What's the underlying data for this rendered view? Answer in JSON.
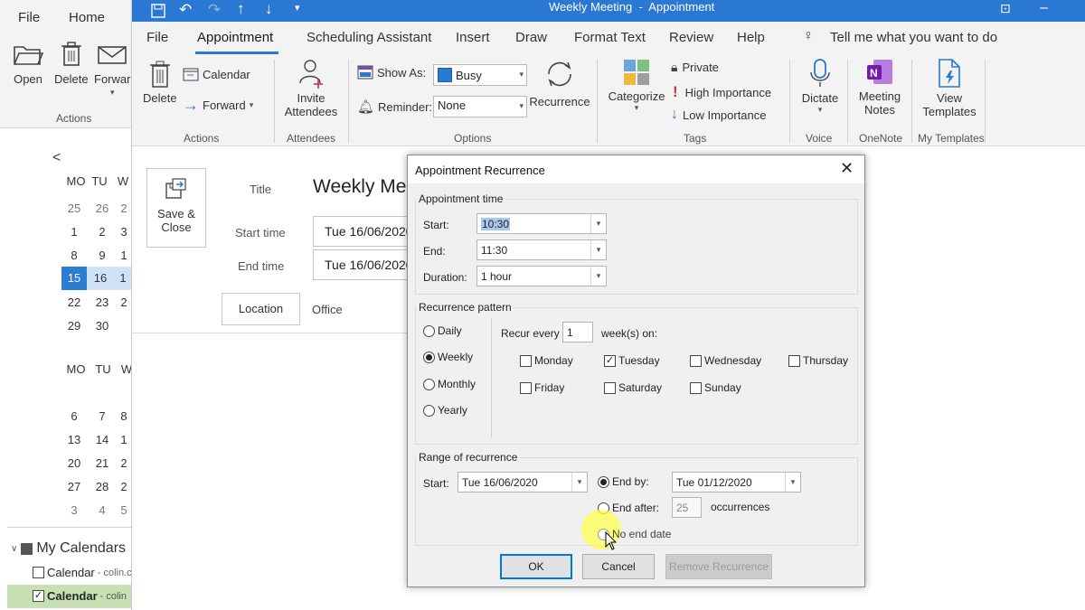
{
  "left_window": {
    "tabs": [
      "File",
      "Home"
    ],
    "ribbon": {
      "open": "Open",
      "delete": "Delete",
      "forward": "Forwar",
      "group": "Actions"
    },
    "calendar": {
      "prev": "<",
      "header1": [
        "MO",
        "TU",
        "W"
      ],
      "weeks1": [
        [
          "25",
          "26",
          "2"
        ],
        [
          "1",
          "2",
          "3"
        ],
        [
          "8",
          "9",
          "1"
        ],
        [
          "15",
          "16",
          "1"
        ],
        [
          "22",
          "23",
          "2"
        ],
        [
          "29",
          "30",
          ""
        ]
      ],
      "header2": [
        "MO",
        "TU",
        "W"
      ],
      "weeks2": [
        [
          "6",
          "7",
          "8"
        ],
        [
          "13",
          "14",
          "1"
        ],
        [
          "20",
          "21",
          "2"
        ],
        [
          "27",
          "28",
          "2"
        ],
        [
          "3",
          "4",
          "5"
        ]
      ]
    },
    "my_calendars": {
      "label": "My Calendars",
      "items": [
        {
          "label": "Calendar",
          "suffix": " - colin.c",
          "checked": false
        },
        {
          "label": "Calendar",
          "suffix": " - colin",
          "checked": true
        }
      ]
    }
  },
  "app_window": {
    "title": "Weekly Meeting  -  Appointment",
    "tabs": [
      "File",
      "Appointment",
      "Scheduling Assistant",
      "Insert",
      "Draw",
      "Format Text",
      "Review",
      "Help"
    ],
    "tell_me": "Tell me what you want to do",
    "ribbon": {
      "delete": "Delete",
      "calendar": "Calendar",
      "forward": "Forward",
      "group_actions": "Actions",
      "invite": "Invite",
      "attendees": "Attendees",
      "group_attendees": "Attendees",
      "show_as_label": "Show As:",
      "show_as_value": "Busy",
      "reminder_label": "Reminder:",
      "reminder_value": "None",
      "recurrence": "Recurrence",
      "group_options": "Options",
      "categorize": "Categorize",
      "private": "Private",
      "high_importance": "High Importance",
      "low_importance": "Low Importance",
      "group_tags": "Tags",
      "dictate": "Dictate",
      "group_voice": "Voice",
      "meeting": "Meeting",
      "notes": "Notes",
      "group_onenote": "OneNote",
      "view": "View",
      "templates": "Templates",
      "group_templates": "My Templates"
    },
    "form": {
      "save": "Save &",
      "close": "Close",
      "title_label": "Title",
      "title_value": "Weekly Mee",
      "start_label": "Start time",
      "start_value": "Tue 16/06/2020",
      "end_label": "End time",
      "end_value": "Tue 16/06/2020",
      "location_btn": "Location",
      "location_value": "Office"
    }
  },
  "dialog": {
    "title": "Appointment Recurrence",
    "appointment_time": {
      "legend": "Appointment time",
      "start_label": "Start:",
      "start_value": "10:30",
      "end_label": "End:",
      "end_value": "11:30",
      "duration_label": "Duration:",
      "duration_value": "1 hour"
    },
    "pattern": {
      "legend": "Recurrence pattern",
      "options": [
        {
          "label": "Daily",
          "selected": false
        },
        {
          "label": "Weekly",
          "selected": true
        },
        {
          "label": "Monthly",
          "selected": false
        },
        {
          "label": "Yearly",
          "selected": false
        }
      ],
      "recur_every_label": "Recur every",
      "recur_every_value": "1",
      "weeks_on": "week(s) on:",
      "days": [
        {
          "label": "Monday",
          "checked": false
        },
        {
          "label": "Tuesday",
          "checked": true
        },
        {
          "label": "Wednesday",
          "checked": false
        },
        {
          "label": "Thursday",
          "checked": false
        },
        {
          "label": "Friday",
          "checked": false
        },
        {
          "label": "Saturday",
          "checked": false
        },
        {
          "label": "Sunday",
          "checked": false
        }
      ]
    },
    "range": {
      "legend": "Range of recurrence",
      "start_label": "Start:",
      "start_value": "Tue 16/06/2020",
      "end_by_label": "End by:",
      "end_by_value": "Tue 01/12/2020",
      "end_after_label": "End after:",
      "end_after_value": "25",
      "occurrences": "occurrences",
      "no_end_label": "No end date"
    },
    "buttons": {
      "ok": "OK",
      "cancel": "Cancel",
      "remove": "Remove Recurrence"
    }
  },
  "colors": {
    "accent": "#2b78d4",
    "highlight": "#ffff66"
  }
}
